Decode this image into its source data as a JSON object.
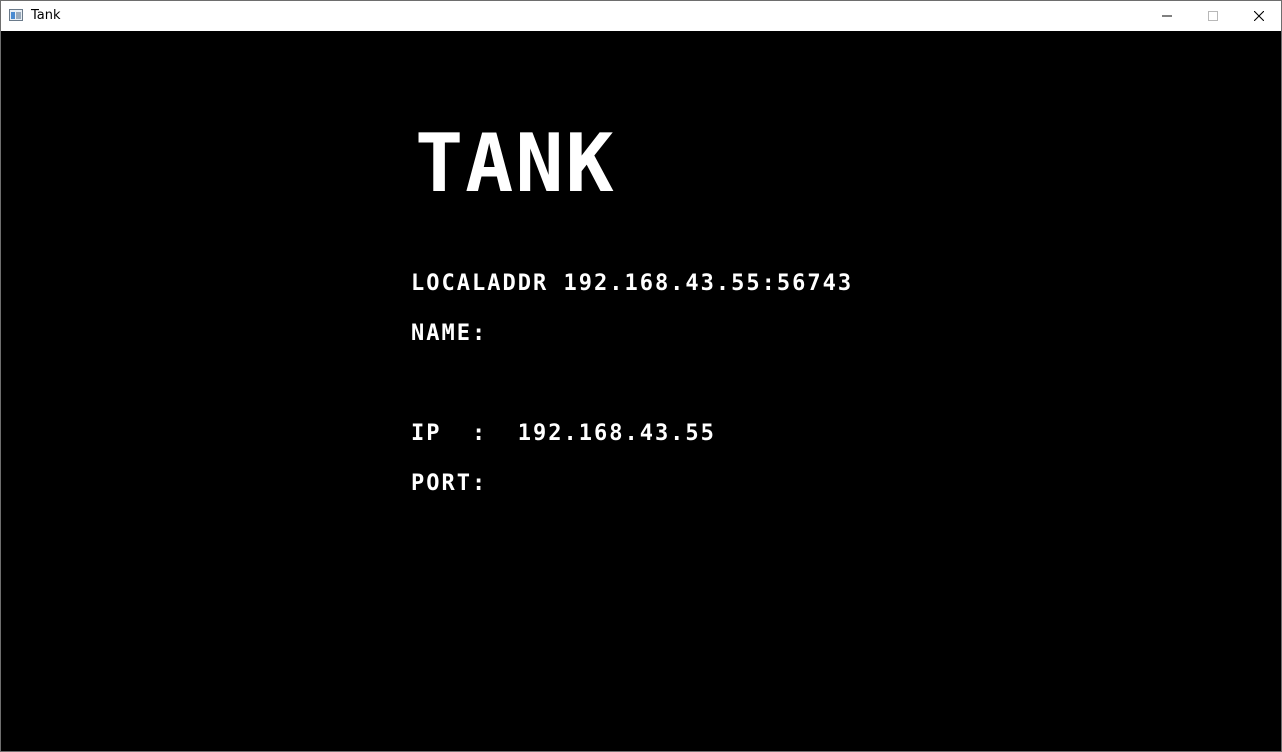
{
  "window": {
    "title": "Tank",
    "icon": "app-window-icon",
    "controls": [
      "minimize-icon",
      "maximize-icon",
      "close-icon"
    ]
  },
  "game": {
    "title": "TANK",
    "local_addr": {
      "label": "LOCALADDR",
      "value": "192.168.43.55:56743"
    },
    "name": {
      "label": "NAME:",
      "value": ""
    },
    "ip": {
      "label": "IP  :",
      "value": "192.168.43.55"
    },
    "port": {
      "label": "PORT:",
      "value": ""
    }
  },
  "colors": {
    "background": "#000000",
    "text": "#ffffff",
    "titlebar": "#ffffff"
  }
}
